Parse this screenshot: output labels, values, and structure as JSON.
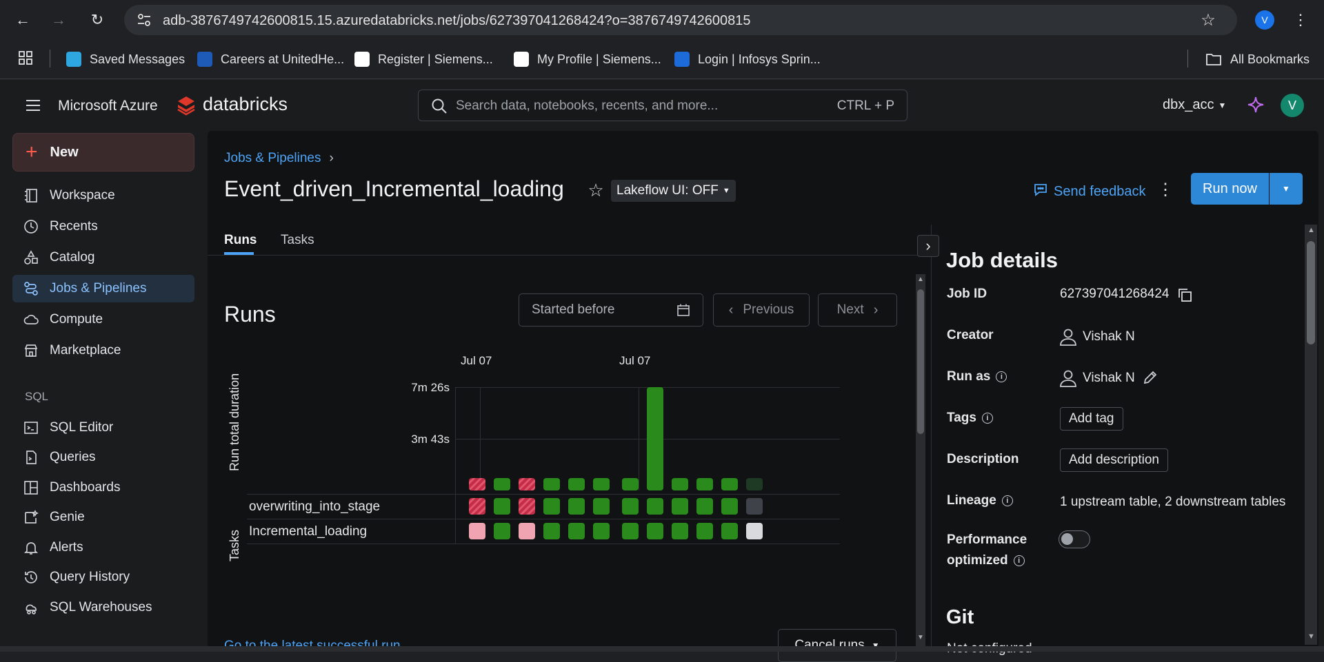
{
  "browser": {
    "url": "adb-3876749742600815.15.azuredatabricks.net/jobs/627397041268424?o=3876749742600815",
    "profile_initial": "V",
    "bookmarks": [
      {
        "label": "Saved Messages",
        "color": "#2ea6e0"
      },
      {
        "label": "Careers at UnitedHe...",
        "color": "#1e5ab8"
      },
      {
        "label": "Register | Siemens...",
        "color": "#ffffff"
      },
      {
        "label": "My Profile | Siemens...",
        "color": "#ffffff"
      },
      {
        "label": "Login | Infosys Sprin...",
        "color": "#1c6bd8"
      }
    ],
    "all_bookmarks": "All Bookmarks"
  },
  "header": {
    "brand_ms": "Microsoft Azure",
    "brand_db": "databricks",
    "search_placeholder": "Search data, notebooks, recents, and more...",
    "search_shortcut": "CTRL + P",
    "workspace": "dbx_acc",
    "avatar": "V"
  },
  "sidebar": {
    "new_label": "New",
    "items": [
      {
        "label": "Workspace",
        "icon": "workspace-icon"
      },
      {
        "label": "Recents",
        "icon": "clock-icon"
      },
      {
        "label": "Catalog",
        "icon": "catalog-icon"
      },
      {
        "label": "Jobs & Pipelines",
        "icon": "jobs-icon",
        "active": true
      },
      {
        "label": "Compute",
        "icon": "cloud-icon"
      },
      {
        "label": "Marketplace",
        "icon": "store-icon"
      }
    ],
    "sql_section": "SQL",
    "sql_items": [
      {
        "label": "SQL Editor",
        "icon": "sql-editor-icon"
      },
      {
        "label": "Queries",
        "icon": "queries-icon"
      },
      {
        "label": "Dashboards",
        "icon": "dashboard-icon"
      },
      {
        "label": "Genie",
        "icon": "genie-icon"
      },
      {
        "label": "Alerts",
        "icon": "bell-icon"
      },
      {
        "label": "Query History",
        "icon": "history-icon"
      },
      {
        "label": "SQL Warehouses",
        "icon": "warehouse-icon"
      }
    ]
  },
  "job": {
    "breadcrumb": "Jobs & Pipelines",
    "title": "Event_driven_Incremental_loading",
    "lakeflow": "Lakeflow UI: OFF",
    "send_feedback": "Send feedback",
    "run_now": "Run now",
    "tabs": [
      "Runs",
      "Tasks"
    ],
    "runs_heading": "Runs",
    "started_before": "Started before",
    "previous": "Previous",
    "next": "Next",
    "latest_link": "Go to the latest successful run",
    "cancel_runs": "Cancel runs"
  },
  "chart_data": {
    "type": "bar",
    "ylabel": "Run total duration",
    "x_date_labels": [
      "Jul 07",
      "Jul 07"
    ],
    "ytick_labels": [
      "7m 26s",
      "3m 43s"
    ],
    "ylim_seconds": [
      0,
      446
    ],
    "runs": [
      {
        "status": "failed",
        "duration_s": 0
      },
      {
        "status": "succeeded",
        "duration_s": 0
      },
      {
        "status": "failed",
        "duration_s": 0
      },
      {
        "status": "succeeded",
        "duration_s": 0
      },
      {
        "status": "succeeded",
        "duration_s": 0
      },
      {
        "status": "succeeded",
        "duration_s": 0
      },
      {
        "status": "succeeded",
        "duration_s": 0
      },
      {
        "status": "succeeded",
        "duration_s": 446
      },
      {
        "status": "succeeded",
        "duration_s": 0
      },
      {
        "status": "succeeded",
        "duration_s": 0
      },
      {
        "status": "succeeded",
        "duration_s": 0
      },
      {
        "status": "running",
        "duration_s": 0
      }
    ],
    "tasks_label": "Tasks",
    "tasks": [
      {
        "name": "overwriting_into_stage",
        "statuses": [
          "fail",
          "ok",
          "fail",
          "ok",
          "ok",
          "ok",
          "ok",
          "ok",
          "ok",
          "ok",
          "ok",
          "grey"
        ]
      },
      {
        "name": "Incremental_loading",
        "statuses": [
          "pink",
          "ok",
          "pink",
          "ok",
          "ok",
          "ok",
          "ok",
          "ok",
          "ok",
          "ok",
          "ok",
          "light"
        ]
      }
    ]
  },
  "details": {
    "heading": "Job details",
    "job_id_label": "Job ID",
    "job_id": "627397041268424",
    "creator_label": "Creator",
    "creator": "Vishak N",
    "run_as_label": "Run as",
    "run_as": "Vishak N",
    "tags_label": "Tags",
    "add_tag": "Add tag",
    "description_label": "Description",
    "add_description": "Add description",
    "lineage_label": "Lineage",
    "lineage_value": "1 upstream table, 2 downstream tables",
    "perf_label_1": "Performance",
    "perf_label_2": "optimized",
    "perf_on": false,
    "git_heading": "Git",
    "git_value": "Not configured"
  }
}
